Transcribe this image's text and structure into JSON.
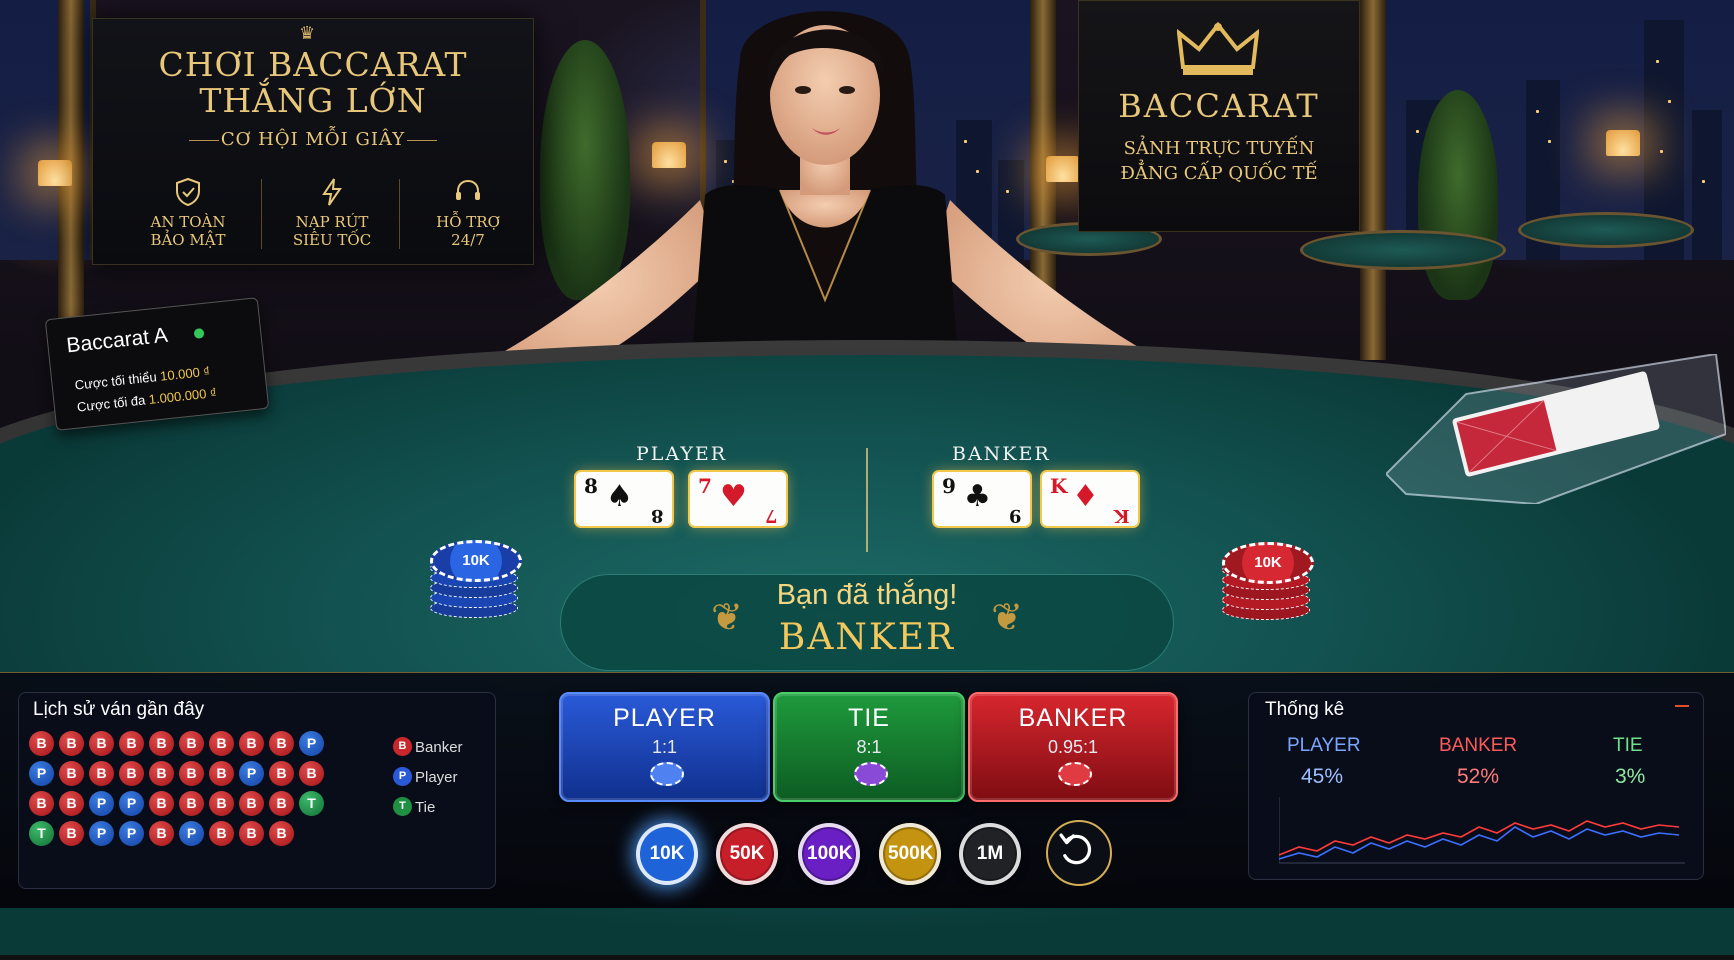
{
  "banner_left": {
    "title_line1": "CHƠI BACCARAT",
    "title_line2": "THẮNG LỚN",
    "subtitle": "CƠ HỘI MỖI GIÂY",
    "features": [
      {
        "icon": "shield-icon",
        "line1": "AN TOÀN",
        "line2": "BẢO MẬT"
      },
      {
        "icon": "lightning-icon",
        "line1": "NẠP RÚT",
        "line2": "SIÊU TỐC"
      },
      {
        "icon": "headset-icon",
        "line1": "HỖ TRỢ",
        "line2": "24/7"
      }
    ]
  },
  "banner_right": {
    "title": "BACCARAT",
    "line1": "SẢNH TRỰC TUYẾN",
    "line2": "ĐẲNG CẤP QUỐC TẾ"
  },
  "table_info": {
    "name": "Baccarat A",
    "min_label": "Cược tối thiểu",
    "min_value": "10.000 ₫",
    "max_label": "Cược tối đa",
    "max_value": "1.000.000 ₫",
    "status_color": "#32c85a"
  },
  "table": {
    "player_label": "PLAYER",
    "banker_label": "BANKER",
    "player_cards": [
      {
        "rank": "8",
        "suit": "♠",
        "color": "black"
      },
      {
        "rank": "7",
        "suit": "♥",
        "color": "red"
      }
    ],
    "banker_cards": [
      {
        "rank": "9",
        "suit": "♣",
        "color": "black"
      },
      {
        "rank": "K",
        "suit": "♦",
        "color": "red"
      }
    ],
    "player_chip_stack": "10K",
    "banker_chip_stack": "10K",
    "result_message": "Bạn đã thắng!",
    "result_winner": "BANKER"
  },
  "history": {
    "title": "Lịch sử ván gần đây",
    "rows": [
      [
        "B",
        "B",
        "B",
        "B",
        "B",
        "B",
        "B",
        "B",
        "B",
        "P"
      ],
      [
        "P",
        "B",
        "B",
        "B",
        "B",
        "B",
        "B",
        "P",
        "B",
        "B"
      ],
      [
        "B",
        "B",
        "P",
        "P",
        "B",
        "B",
        "B",
        "B",
        "B",
        "T"
      ],
      [
        "T",
        "B",
        "P",
        "P",
        "B",
        "P",
        "B",
        "B",
        "B",
        ""
      ]
    ],
    "legend": [
      {
        "code": "B",
        "label": "Banker"
      },
      {
        "code": "P",
        "label": "Player"
      },
      {
        "code": "T",
        "label": "Tie"
      }
    ]
  },
  "bets": {
    "player": {
      "label": "PLAYER",
      "odds": "1:1"
    },
    "tie": {
      "label": "TIE",
      "odds": "8:1"
    },
    "banker": {
      "label": "BANKER",
      "odds": "0.95:1"
    }
  },
  "chips": [
    {
      "label": "10K",
      "selected": true
    },
    {
      "label": "50K"
    },
    {
      "label": "100K"
    },
    {
      "label": "500K"
    },
    {
      "label": "1M"
    }
  ],
  "undo_icon": "undo-icon",
  "stats": {
    "title": "Thống kê",
    "player_label": "PLAYER",
    "player_pct": "45%",
    "banker_label": "BANKER",
    "banker_pct": "52%",
    "tie_label": "TIE",
    "tie_pct": "3%",
    "colors": {
      "player": "#5b8cff",
      "banker": "#ff4a4a",
      "tie": "#4fd06e"
    }
  }
}
